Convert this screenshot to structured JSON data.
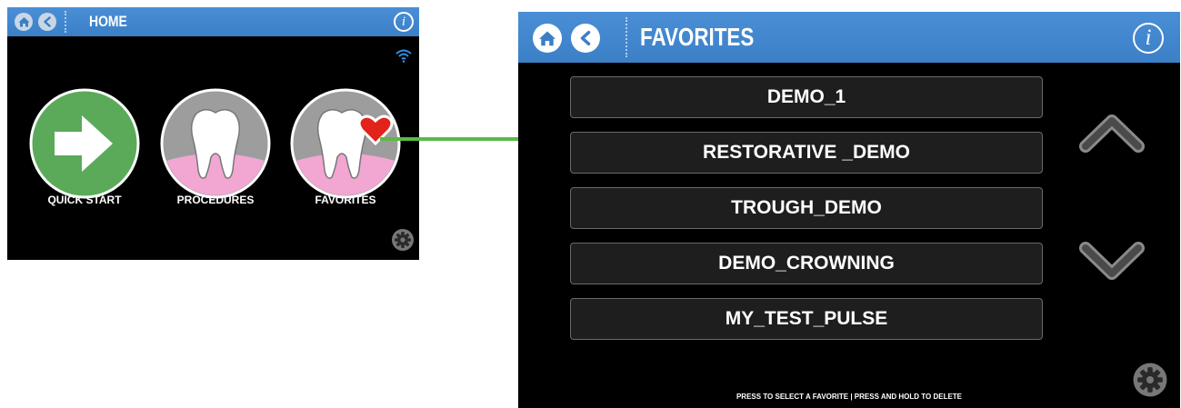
{
  "home": {
    "title": "HOME",
    "info_label": "i",
    "tiles": [
      {
        "label": "QUICK START"
      },
      {
        "label": "PROCEDURES"
      },
      {
        "label": "FAVORITES"
      }
    ]
  },
  "favorites": {
    "title": "FAVORITES",
    "info_label": "i",
    "items": [
      {
        "label": "DEMO_1"
      },
      {
        "label": "RESTORATIVE _DEMO"
      },
      {
        "label": "TROUGH_DEMO"
      },
      {
        "label": "DEMO_CROWNING"
      },
      {
        "label": "MY_TEST_PULSE"
      }
    ],
    "footer": "PRESS TO SELECT A FAVORITE | PRESS AND HOLD TO DELETE"
  },
  "colors": {
    "titlebar": "#3b7fc7",
    "arrow": "#5cb848",
    "quick_start": "#5aaa5a",
    "gum": "#f2a6d2",
    "heart": "#e2231a"
  },
  "icons": [
    "home-icon",
    "back-icon",
    "info-icon",
    "wifi-icon",
    "settings-icon",
    "chevron-up-icon",
    "chevron-down-icon",
    "arrow-right-icon",
    "tooth-icon",
    "heart-icon"
  ]
}
